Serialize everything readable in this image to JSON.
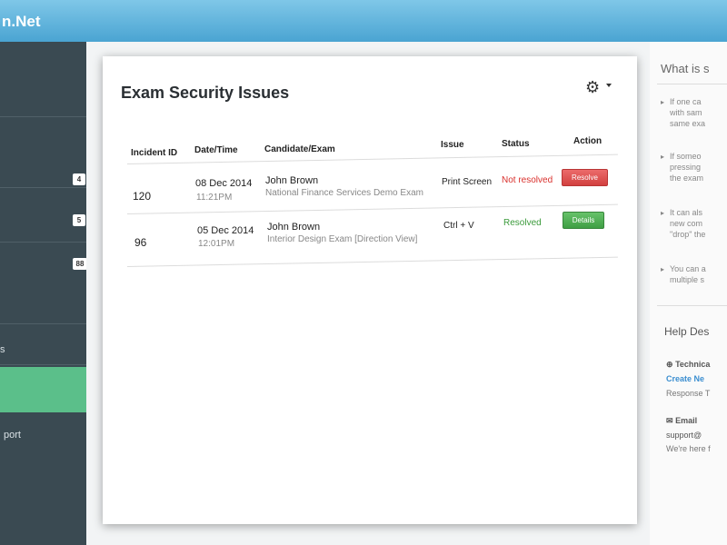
{
  "app": {
    "brand": "n.Net"
  },
  "sidebar": {
    "badges": [
      "4",
      "5",
      "88"
    ],
    "items": [
      {
        "label": "s"
      },
      {
        "label": "port"
      }
    ]
  },
  "card": {
    "title": "Exam Security Issues",
    "settings_icon": "gear-icon",
    "columns": [
      "Incident ID",
      "Date/Time",
      "Candidate/Exam",
      "Issue",
      "Status",
      "Action"
    ],
    "rows": [
      {
        "id": "120",
        "date": "08 Dec 2014",
        "time": "11:21PM",
        "candidate": "John Brown",
        "exam": "National Finance Services Demo Exam",
        "issue": "Print Screen",
        "status": "Not resolved",
        "action": "Resolve"
      },
      {
        "id": "96",
        "date": "05 Dec 2014",
        "time": "12:01PM",
        "candidate": "John Brown",
        "exam": "Interior Design Exam [Direction View]",
        "issue": "Ctrl + V",
        "status": "Resolved",
        "action": "Details"
      }
    ]
  },
  "right_panel": {
    "title": "What is s",
    "items": [
      [
        "If one ca",
        "with sam",
        "same exa"
      ],
      [
        "If someo",
        "pressing",
        "the exam"
      ],
      [
        "It can als",
        "new com",
        "\"drop\" the"
      ],
      [
        "You can a",
        "multiple s"
      ]
    ],
    "help_title": "Help Des",
    "technical_label": "Technica",
    "create_link": "Create Ne",
    "response_text": "Response T",
    "email_label": "Email",
    "email_value": "support@",
    "email_note": "We're here f"
  },
  "colors": {
    "topbar": "#4aa4d2",
    "sidebar": "#3a4a52",
    "sidebar_active": "#5bbf8a",
    "status_unresolved": "#d9302c",
    "status_resolved": "#3a9a3a",
    "resolve_button": "#d2403f",
    "details_button": "#3f9f44"
  }
}
